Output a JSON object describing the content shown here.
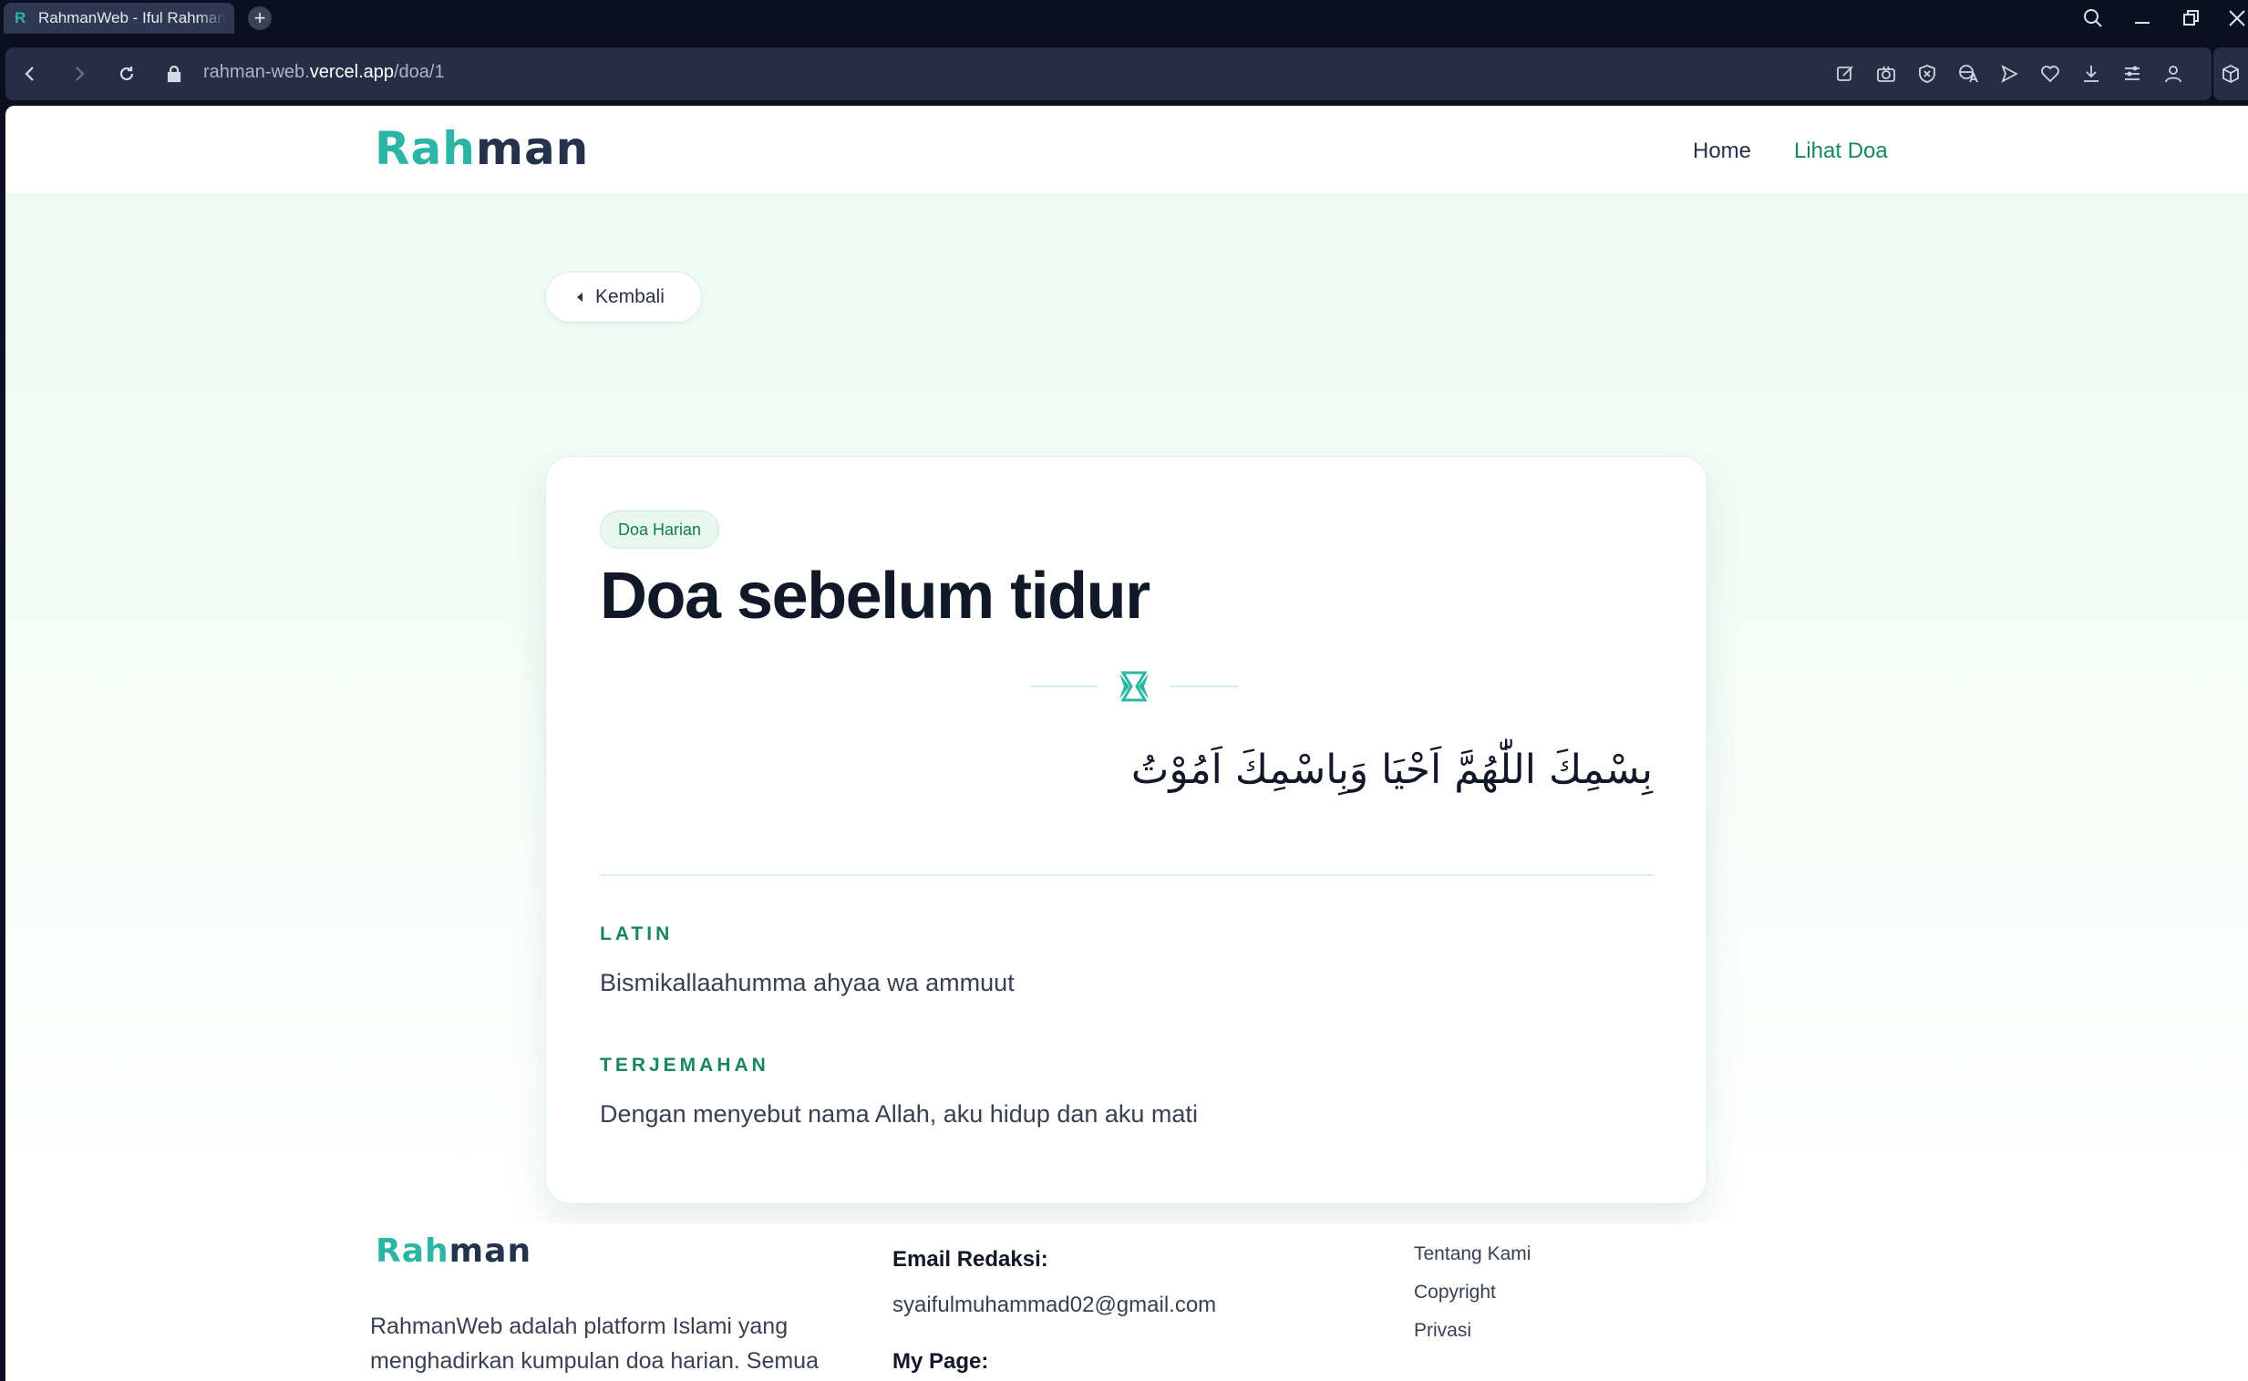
{
  "browser": {
    "tab_title": "RahmanWeb - Iful Rahman",
    "tab_favicon": "R",
    "new_tab_symbol": "+",
    "url_prefix": "rahman-web.",
    "url_host": "vercel.app",
    "url_path": "/doa/1",
    "icons": [
      "search-icon",
      "minimize-icon",
      "restore-icon",
      "close-icon",
      "back-icon",
      "forward-icon",
      "reload-icon",
      "lock-icon",
      "edit-icon",
      "camera-icon",
      "shield-icon",
      "translate-icon",
      "send-icon",
      "heart-icon",
      "download-icon",
      "menu-icon",
      "profile-icon",
      "extension-icon"
    ]
  },
  "header": {
    "logo_part1": "Rah",
    "logo_part2": "man",
    "nav": [
      {
        "label": "Home",
        "color": "#25324b"
      },
      {
        "label": "Lihat Doa",
        "color": "#168562"
      }
    ]
  },
  "back_button": {
    "label": "Kembali"
  },
  "doa": {
    "category": "Doa Harian",
    "title": "Doa sebelum tidur",
    "arabic": "بِسْمِكَ اللّٰهُمَّ اَحْيَا وَبِاسْمِكَ اَمُوْتُ",
    "latin_label": "LATIN",
    "latin": "Bismikallaahumma ahyaa wa ammuut",
    "translation_label": "TERJEMAHAN",
    "translation": "Dengan menyebut nama Allah, aku hidup dan aku mati"
  },
  "footer": {
    "logo_part1": "Rah",
    "logo_part2": "man",
    "description": "RahmanWeb adalah platform Islami yang menghadirkan kumpulan doa harian. Semua",
    "email_heading": "Email Redaksi:",
    "email": "syaifulmuhammad02@gmail.com",
    "mypage_heading": "My Page:",
    "links": [
      "Tentang Kami",
      "Copyright",
      "Privasi"
    ]
  },
  "colors": {
    "accent": "#2ab5a5",
    "brand_dark": "#25324b",
    "label_green": "#168562"
  }
}
